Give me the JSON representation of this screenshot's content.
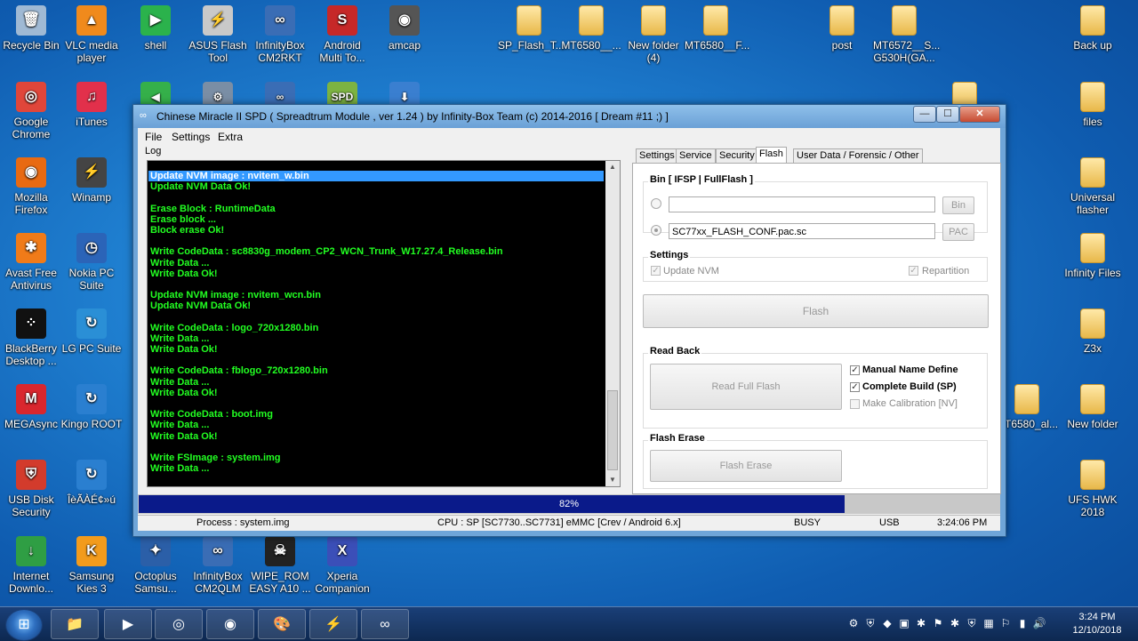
{
  "desktop": {
    "icons": [
      {
        "label": "Recycle Bin",
        "glyph": "🗑",
        "color": "#9fb9d4"
      },
      {
        "label": "VLC media player",
        "glyph": "▲",
        "color": "#f08a1c"
      },
      {
        "label": "shell",
        "glyph": "▶",
        "color": "#2bb24c"
      },
      {
        "label": "ASUS Flash Tool",
        "glyph": "⚡",
        "color": "#c9c9c9"
      },
      {
        "label": "InfinityBox CM2RKT",
        "glyph": "∞",
        "color": "#3a6db5"
      },
      {
        "label": "Android Multi To...",
        "glyph": "S",
        "color": "#c62828"
      },
      {
        "label": "amcap",
        "glyph": "◉",
        "color": "#555555"
      },
      {
        "label": "SP_Flash_T...",
        "glyph": "",
        "color": "folder"
      },
      {
        "label": "MT6580__...",
        "glyph": "",
        "color": "folder"
      },
      {
        "label": "New folder (4)",
        "glyph": "",
        "color": "folder"
      },
      {
        "label": "MT6580__F...",
        "glyph": "",
        "color": "folder"
      },
      {
        "label": "post",
        "glyph": "",
        "color": "folder"
      },
      {
        "label": "MT6572__S... G530H(GA...",
        "glyph": "",
        "color": "folder"
      },
      {
        "label": "Back up",
        "glyph": "",
        "color": "folder"
      },
      {
        "label": "Google Chrome",
        "glyph": "◎",
        "color": "#e0463a"
      },
      {
        "label": "iTunes",
        "glyph": "♫",
        "color": "#e2304b"
      },
      {
        "label": "files",
        "glyph": "",
        "color": "folder"
      },
      {
        "label": "Mozilla Firefox",
        "glyph": "◉",
        "color": "#e86a12"
      },
      {
        "label": "Winamp",
        "glyph": "⚡",
        "color": "#444444"
      },
      {
        "label": "Universal flasher",
        "glyph": "",
        "color": "folder"
      },
      {
        "label": "Avast Free Antivirus",
        "glyph": "✱",
        "color": "#f07b19"
      },
      {
        "label": "Nokia PC Suite",
        "glyph": "◷",
        "color": "#2b64b8"
      },
      {
        "label": "Infinity Files",
        "glyph": "",
        "color": "folder"
      },
      {
        "label": "BlackBerry Desktop ...",
        "glyph": "⁘",
        "color": "#111111"
      },
      {
        "label": "LG PC Suite",
        "glyph": "↻",
        "color": "#2a8fd6"
      },
      {
        "label": "Z3x",
        "glyph": "",
        "color": "folder"
      },
      {
        "label": "MEGAsync",
        "glyph": "M",
        "color": "#d9272e"
      },
      {
        "label": "Kingo ROOT",
        "glyph": "↻",
        "color": "#2a7fd0"
      },
      {
        "label": "MT6580_al...",
        "glyph": "",
        "color": "folder"
      },
      {
        "label": "New folder",
        "glyph": "",
        "color": "folder"
      },
      {
        "label": "USB Disk Security",
        "glyph": "⛨",
        "color": "#d33b2c"
      },
      {
        "label": "ÎèÃÀÉ¢»ú",
        "glyph": "↻",
        "color": "#2a7fd0"
      },
      {
        "label": "UFS HWK 2018",
        "glyph": "",
        "color": "folder"
      },
      {
        "label": "Internet Downlo...",
        "glyph": "↓",
        "color": "#2f9e44"
      },
      {
        "label": "Samsung Kies 3",
        "glyph": "K",
        "color": "#f29b1c"
      },
      {
        "label": "Octoplus Samsu...",
        "glyph": "✦",
        "color": "#2b5fa8"
      },
      {
        "label": "InfinityBox CM2QLM",
        "glyph": "∞",
        "color": "#3a6db5"
      },
      {
        "label": "WIPE_ROM EASY A10 ...",
        "glyph": "☠",
        "color": "#222222"
      },
      {
        "label": "Xperia Companion",
        "glyph": "X",
        "color": "#3b4fb8"
      }
    ],
    "partial_icons": [
      {
        "glyph": "◀",
        "color": "#35b04a"
      },
      {
        "glyph": "⚙",
        "color": "#7a8ea5"
      },
      {
        "glyph": "∞",
        "color": "#3a6db5"
      },
      {
        "glyph": "SPD",
        "color": "#7cb342"
      },
      {
        "glyph": "⬇",
        "color": "#3a7fd0"
      },
      {
        "glyph": "",
        "color": "folder"
      }
    ]
  },
  "window": {
    "title": "Chinese Miracle II SPD ( Spreadtrum Module , ver 1.24 ) by Infinity-Box Team (c) 2014-2016 [ Dream #11 ;) ]",
    "buttons": {
      "minimize": "—",
      "maximize": "☐",
      "close": "✕"
    },
    "menu": [
      "File",
      "Settings",
      "Extra"
    ],
    "log_label": "Log",
    "log_lines": [
      "Update NVM image : nvitem_w.bin",
      "Update NVM Data Ok!",
      "",
      "Erase Block : RuntimeData",
      "Erase block ...",
      "Block erase Ok!",
      "",
      "Write CodeData : sc8830g_modem_CP2_WCN_Trunk_W17.27.4_Release.bin",
      "Write Data ...",
      "Write Data Ok!",
      "",
      "Update NVM image : nvitem_wcn.bin",
      "Update NVM Data Ok!",
      "",
      "Write CodeData : logo_720x1280.bin",
      "Write Data ...",
      "Write Data Ok!",
      "",
      "Write CodeData : fblogo_720x1280.bin",
      "Write Data ...",
      "Write Data Ok!",
      "",
      "Write CodeData : boot.img",
      "Write Data ...",
      "Write Data Ok!",
      "",
      "Write FSImage : system.img",
      "Write Data ..."
    ],
    "tabs": [
      "Settings",
      "Service",
      "Security",
      "Flash",
      "User Data / Forensic / Other"
    ],
    "active_tab": "Flash",
    "bin_group": {
      "title": "Bin  [ IFSP | FullFlash ]",
      "bin_path": "",
      "pac_path": "SC77xx_FLASH_CONF.pac.sc",
      "bin_button": "Bin",
      "pac_button": "PAC"
    },
    "settings_group": {
      "title": "Settings",
      "update_nvm": "Update NVM",
      "update_nvm_checked": true,
      "repartition": "Repartition",
      "repartition_checked": true
    },
    "flash_button": "Flash",
    "readback_group": {
      "title": "Read Back",
      "read_full_flash": "Read Full Flash",
      "manual_name": "Manual Name Define",
      "manual_name_checked": true,
      "complete_build": "Complete Build (SP)",
      "complete_build_checked": true,
      "make_calibration": "Make Calibration [NV]",
      "make_calibration_checked": false
    },
    "erase_group": {
      "title": "Flash Erase",
      "button": "Flash Erase"
    },
    "progress": {
      "percent": 82,
      "label": "82%"
    },
    "status": {
      "process": "Process : system.img",
      "cpu": "CPU : SP [SC7730..SC7731] eMMC [Crev / Android 6.x]",
      "state": "BUSY",
      "port": "USB",
      "time": "3:24:06 PM"
    }
  },
  "taskbar": {
    "start_glyph": "⊞",
    "items": [
      {
        "name": "explorer",
        "glyph": "📁"
      },
      {
        "name": "media-player",
        "glyph": "▶"
      },
      {
        "name": "chrome",
        "glyph": "◎"
      },
      {
        "name": "firefox",
        "glyph": "◉"
      },
      {
        "name": "paint",
        "glyph": "🎨"
      },
      {
        "name": "winamp",
        "glyph": "⚡"
      },
      {
        "name": "spd",
        "glyph": "∞"
      }
    ],
    "tray": [
      "⚙",
      "⛨",
      "◆",
      "▣",
      "✱",
      "⚑",
      "✱",
      "⛨",
      "▦",
      "⚐",
      "▮",
      "🔊"
    ],
    "clock_time": "3:24 PM",
    "clock_date": "12/10/2018"
  },
  "colors": {
    "log_text": "#22ff22",
    "log_selected": "#3399ff",
    "progress_fill": "#0a1a8a"
  }
}
